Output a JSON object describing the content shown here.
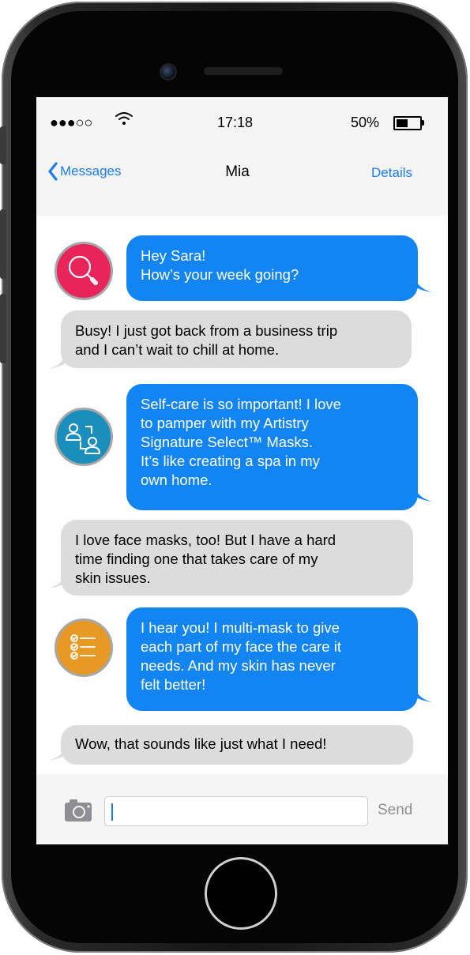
{
  "status_bar": {
    "signal": "●●●○○",
    "time": "17:18",
    "battery_percent": "50%",
    "battery_level": 0.5
  },
  "nav": {
    "back_label": "Messages",
    "title": "Mia",
    "details_label": "Details"
  },
  "messages": [
    {
      "direction": "out",
      "lines": [
        "Hey Sara!",
        "How’s your week going?"
      ]
    },
    {
      "direction": "in",
      "lines": [
        "Busy! I just got back from a business trip",
        "and I can’t wait to chill at home."
      ]
    },
    {
      "direction": "out",
      "lines": [
        "Self-care is so important! I love",
        "to pamper with my Artistry",
        "Signature Select™ Masks.",
        "It’s like creating a spa in my",
        "own home."
      ]
    },
    {
      "direction": "in",
      "lines": [
        "I love face masks, too! But I have a hard",
        "time finding one that takes care of my",
        "skin issues."
      ]
    },
    {
      "direction": "out",
      "lines": [
        "I hear you! I multi-mask to give",
        "each part of my face the care it",
        "needs. And my skin has never",
        "felt better!"
      ]
    },
    {
      "direction": "in",
      "lines": [
        "Wow, that sounds like just what I need!"
      ]
    }
  ],
  "avatars": [
    {
      "icon": "magnifier-icon",
      "color": "#e8245a"
    },
    {
      "icon": "people-exchange-icon",
      "color": "#1a8fbd"
    },
    {
      "icon": "checklist-icon",
      "color": "#e69a25"
    }
  ],
  "composer": {
    "input_value": "",
    "send_label": "Send",
    "camera_icon": "camera-icon"
  },
  "colors": {
    "outgoing_bubble": "#1385f3",
    "incoming_bubble": "#dcdcdc",
    "accent": "#1a7cf5"
  }
}
